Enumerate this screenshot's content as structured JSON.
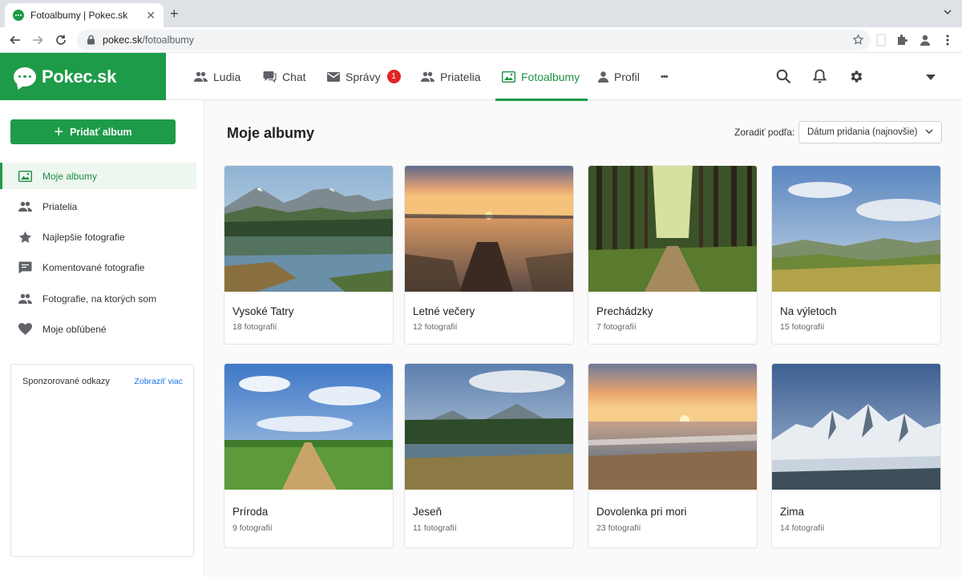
{
  "browser": {
    "tab_title": "Fotoalbumy | Pokec.sk",
    "url_domain": "pokec.sk",
    "url_path": "/fotoalbumy"
  },
  "site": {
    "brand": "Pokec.sk",
    "accent_color": "#1e9b48",
    "nav": [
      {
        "label": "Ludia",
        "icon": "people-icon"
      },
      {
        "label": "Chat",
        "icon": "chat-icon"
      },
      {
        "label": "Správy",
        "icon": "mail-icon",
        "badge": "1"
      },
      {
        "label": "Priatelia",
        "icon": "friends-icon"
      },
      {
        "label": "Fotoalbumy",
        "icon": "photo-icon",
        "active": true
      },
      {
        "label": "Profil",
        "icon": "person-icon"
      },
      {
        "label": "•••",
        "icon": "more-icon"
      }
    ]
  },
  "sidebar": {
    "add_button": "Pridať album",
    "items": [
      {
        "label": "Moje albumy",
        "icon": "photo-icon",
        "active": true
      },
      {
        "label": "Priatelia",
        "icon": "friends-icon"
      },
      {
        "label": "Najlepšie fotografie",
        "icon": "star-icon"
      },
      {
        "label": "Komentované fotografie",
        "icon": "comment-icon"
      },
      {
        "label": "Fotografie, na ktorých som",
        "icon": "tagged-people-icon"
      },
      {
        "label": "Moje obľúbené",
        "icon": "heart-icon"
      }
    ],
    "sponsored": {
      "label": "Sponzorované odkazy",
      "more": "Zobraziť viac"
    }
  },
  "main": {
    "title": "Moje albumy",
    "sort_label": "Zoradiť podľa:",
    "sort_value": "Dátum pridania (najnovšie)",
    "albums": [
      {
        "name": "Vysoké Tatry",
        "count": "18 fotografií",
        "thumb": "mountain-lake-photo"
      },
      {
        "name": "Letné večery",
        "count": "12 fotografií",
        "thumb": "sunset-pier-photo"
      },
      {
        "name": "Prechádzky",
        "count": "7 fotografií",
        "thumb": "forest-path-photo"
      },
      {
        "name": "Na výletoch",
        "count": "15 fotografií",
        "thumb": "hills-photo"
      },
      {
        "name": "Príroda",
        "count": "9 fotografií",
        "thumb": "field-road-photo"
      },
      {
        "name": "Jeseň",
        "count": "11 fotografií",
        "thumb": "autumn-lake-photo"
      },
      {
        "name": "Dovolenka pri mori",
        "count": "23 fotografií",
        "thumb": "sea-sunset-photo"
      },
      {
        "name": "Zima",
        "count": "14 fotografií",
        "thumb": "snowy-mountains-photo"
      }
    ]
  }
}
